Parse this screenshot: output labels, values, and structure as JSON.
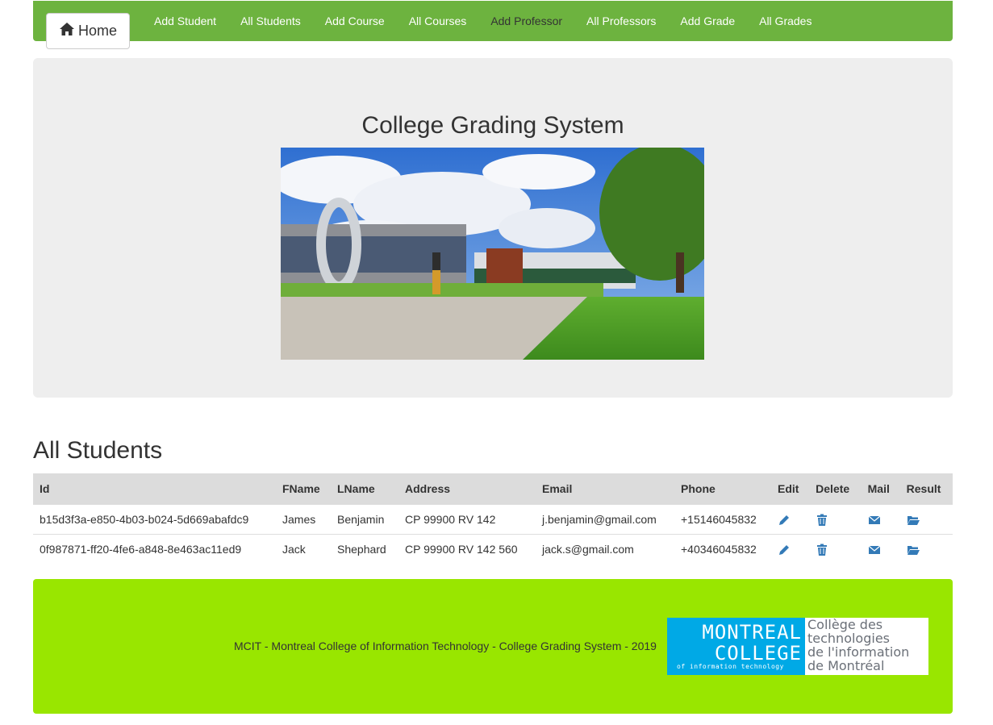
{
  "nav": {
    "home_label": "Home",
    "links": [
      "Add Student",
      "All Students",
      "Add Course",
      "All Courses",
      "Add Professor",
      "All Professors",
      "Add Grade",
      "All Grades"
    ]
  },
  "hero": {
    "title": "College Grading System"
  },
  "students": {
    "title": "All Students",
    "columns": [
      "Id",
      "FName",
      "LName",
      "Address",
      "Email",
      "Phone",
      "Edit",
      "Delete",
      "Mail",
      "Result"
    ],
    "rows": [
      {
        "id": "b15d3f3a-e850-4b03-b024-5d669abafdc9",
        "fname": "James",
        "lname": "Benjamin",
        "address": "CP 99900 RV 142",
        "email": "j.benjamin@gmail.com",
        "phone": "+15146045832"
      },
      {
        "id": "0f987871-ff20-4fe6-a848-8e463ac11ed9",
        "fname": "Jack",
        "lname": "Shephard",
        "address": "CP 99900 RV 142 560",
        "email": "jack.s@gmail.com",
        "phone": "+40346045832"
      }
    ]
  },
  "footer": {
    "text": "MCIT - Montreal College of Information Technology - College Grading System - 2019",
    "logo": {
      "line1": "MONTREAL",
      "line2": "COLLEGE",
      "line3": "of information technology",
      "fr1": "Collège des",
      "fr2": "technologies",
      "fr3": "de l'information",
      "fr4": "de Montréal"
    }
  },
  "colors": {
    "nav_bg": "#6db33f",
    "footer_bg": "#99e600",
    "icon_blue": "#337ab7",
    "logo_blue": "#00a9e6"
  },
  "icons": {
    "home": "home-icon",
    "edit": "pencil-icon",
    "delete": "trash-icon",
    "mail": "envelope-icon",
    "result": "folder-open-icon"
  }
}
